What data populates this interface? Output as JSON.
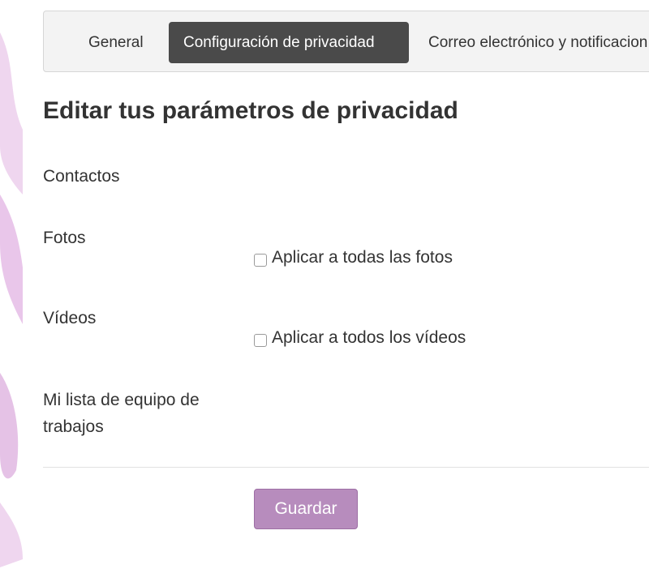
{
  "tabs": [
    {
      "label": "General",
      "active": false
    },
    {
      "label": "Configuración de privacidad",
      "active": true
    },
    {
      "label": "Correo electrónico y notificacion",
      "active": false
    }
  ],
  "page_title": "Editar tus parámetros de privacidad",
  "sections": {
    "contacts": {
      "label": "Contactos"
    },
    "photos": {
      "label": "Fotos",
      "checkbox_label": "Aplicar a todas las fotos",
      "checked": false
    },
    "videos": {
      "label": "Vídeos",
      "checkbox_label": "Aplicar a todos los vídeos",
      "checked": false
    },
    "work_team": {
      "label_line1": "Mi lista de equipo de",
      "label_line2": "trabajos"
    }
  },
  "save_button": {
    "label": "Guardar"
  },
  "colors": {
    "accent": "#b78cbd",
    "active_tab": "#4a4a4a",
    "decor": "#e9cbe9"
  }
}
